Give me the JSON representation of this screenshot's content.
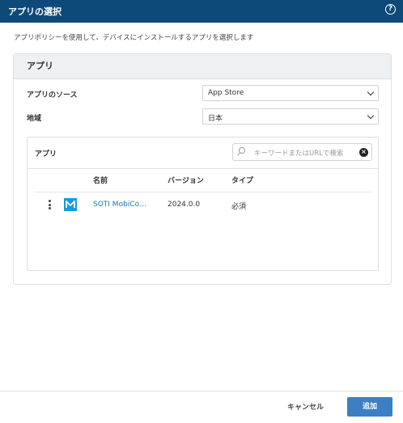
{
  "dialog": {
    "title": "アプリの選択",
    "help_icon": "help-circle-icon",
    "help_glyph": "?",
    "description": "アプリポリシーを使用して、デバイスにインストールするアプリを選択します"
  },
  "card": {
    "header": "アプリ",
    "source_label": "アプリのソース",
    "source_value": "App Store",
    "region_label": "地域",
    "region_value": "日本"
  },
  "apps_panel": {
    "title": "アプリ",
    "search_placeholder": "キーワードまたはURLで検索",
    "columns": {
      "name": "名前",
      "version": "バージョン",
      "type": "タイプ"
    },
    "rows": [
      {
        "name": "SOTI MobiCo…",
        "version": "2024.0.0",
        "type": "必須",
        "icon": "mobicontrol-app-icon"
      }
    ]
  },
  "footer": {
    "cancel_label": "キャンセル",
    "add_label": "追加"
  },
  "colors": {
    "titlebar": "#0d4a7a",
    "accent_button": "#3d7fc2",
    "link": "#1b73b3",
    "app_icon": "#1a9ad6"
  }
}
